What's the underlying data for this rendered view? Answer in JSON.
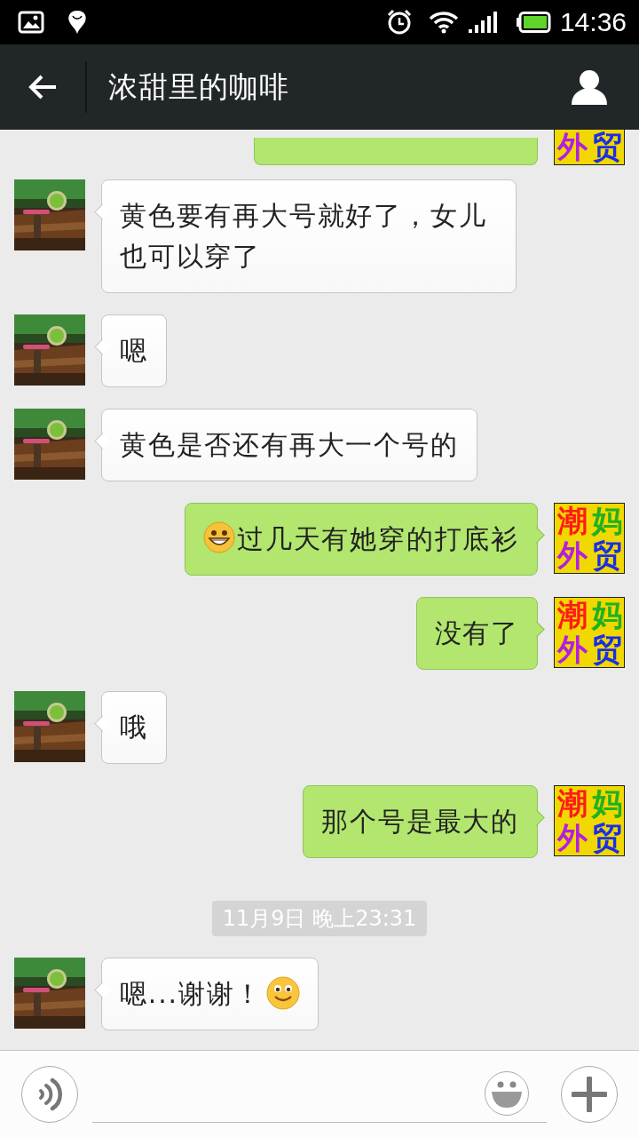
{
  "status_bar": {
    "time": "14:36"
  },
  "header": {
    "title": "浓甜里的咖啡"
  },
  "messages": [
    {
      "kind": "clipped",
      "avatar_chars": [
        "外",
        "贸"
      ]
    },
    {
      "kind": "incoming",
      "content": [
        {
          "kind": "text",
          "text": "黄色要有再大号就好了，女儿也可以穿了"
        }
      ]
    },
    {
      "kind": "incoming",
      "content": [
        {
          "kind": "text",
          "text": "嗯"
        }
      ]
    },
    {
      "kind": "incoming",
      "content": [
        {
          "kind": "text",
          "text": "黄色是否还有再大一个号的"
        }
      ]
    },
    {
      "kind": "outgoing",
      "content": [
        {
          "kind": "grin"
        },
        {
          "kind": "text",
          "text": "过几天有她穿的打底衫"
        }
      ],
      "avatar_chars": [
        "潮",
        "妈",
        "外",
        "贸"
      ]
    },
    {
      "kind": "outgoing",
      "content": [
        {
          "kind": "text",
          "text": "没有了"
        }
      ],
      "avatar_chars": [
        "潮",
        "妈",
        "外",
        "贸"
      ]
    },
    {
      "kind": "incoming",
      "content": [
        {
          "kind": "text",
          "text": "哦"
        }
      ]
    },
    {
      "kind": "outgoing",
      "content": [
        {
          "kind": "text",
          "text": "那个号是最大的"
        }
      ],
      "avatar_chars": [
        "潮",
        "妈",
        "外",
        "贸"
      ]
    },
    {
      "kind": "time",
      "text": "11月9日 晚上23:31"
    },
    {
      "kind": "incoming",
      "content": [
        {
          "kind": "text",
          "text": "嗯...谢谢！"
        },
        {
          "kind": "smile"
        }
      ]
    }
  ]
}
